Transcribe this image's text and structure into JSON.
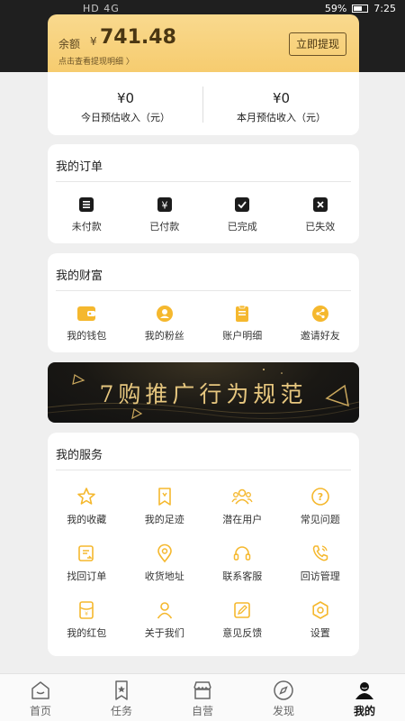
{
  "status": {
    "time": "7:25",
    "battery": "59%",
    "left": "HD 4G"
  },
  "balance": {
    "label": "余额",
    "currency": "¥",
    "amount": "741.48",
    "detail_link": "点击查看提现明细 〉",
    "withdraw_label": "立即提现"
  },
  "income": [
    {
      "value": "¥0",
      "label": "今日预估收入（元）"
    },
    {
      "value": "¥0",
      "label": "本月预估收入（元）"
    }
  ],
  "orders": {
    "title": "我的订单",
    "items": [
      {
        "label": "未付款",
        "icon": "clipboard-icon"
      },
      {
        "label": "已付款",
        "icon": "yen-icon"
      },
      {
        "label": "已完成",
        "icon": "check-icon"
      },
      {
        "label": "已失效",
        "icon": "x-icon"
      }
    ]
  },
  "wealth": {
    "title": "我的财富",
    "items": [
      {
        "label": "我的钱包",
        "icon": "wallet-icon"
      },
      {
        "label": "我的粉丝",
        "icon": "fans-icon"
      },
      {
        "label": "账户明细",
        "icon": "ledger-icon"
      },
      {
        "label": "邀请好友",
        "icon": "share-icon"
      }
    ]
  },
  "banner": {
    "text": "7购推广行为规范"
  },
  "services": {
    "title": "我的服务",
    "items": [
      {
        "label": "我的收藏",
        "icon": "star-icon"
      },
      {
        "label": "我的足迹",
        "icon": "footprint-icon"
      },
      {
        "label": "潜在用户",
        "icon": "users-icon"
      },
      {
        "label": "常见问题",
        "icon": "question-icon"
      },
      {
        "label": "找回订单",
        "icon": "retrieve-order-icon"
      },
      {
        "label": "收货地址",
        "icon": "location-icon"
      },
      {
        "label": "联系客服",
        "icon": "headset-icon"
      },
      {
        "label": "回访管理",
        "icon": "phone-icon"
      },
      {
        "label": "我的红包",
        "icon": "red-packet-icon"
      },
      {
        "label": "关于我们",
        "icon": "person-icon"
      },
      {
        "label": "意见反馈",
        "icon": "edit-icon"
      },
      {
        "label": "设置",
        "icon": "settings-icon"
      }
    ]
  },
  "tabs": [
    {
      "label": "首页",
      "icon": "home-icon"
    },
    {
      "label": "任务",
      "icon": "task-icon"
    },
    {
      "label": "自营",
      "icon": "store-icon"
    },
    {
      "label": "发现",
      "icon": "compass-icon"
    },
    {
      "label": "我的",
      "icon": "profile-icon",
      "active": true
    }
  ],
  "colors": {
    "accent": "#f5b82e",
    "card_gold": "#f8d27d",
    "dark": "#1f1f1f"
  }
}
